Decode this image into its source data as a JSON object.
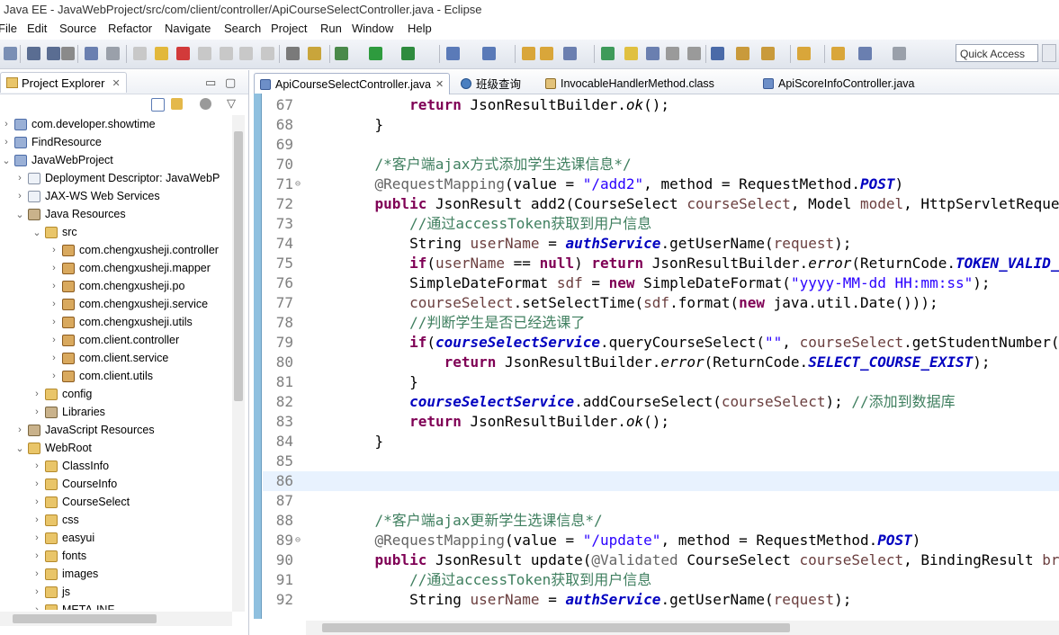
{
  "window": {
    "title": "Java EE - JavaWebProject/src/com/client/controller/ApiCourseSelectController.java - Eclipse"
  },
  "menu": [
    "File",
    "Edit",
    "Source",
    "Refactor",
    "Navigate",
    "Search",
    "Project",
    "Run",
    "Window",
    "Help"
  ],
  "toolbar": {
    "quick_access": "Quick Access"
  },
  "project_explorer": {
    "title": "Project Explorer",
    "items": [
      {
        "label": "com.developer.showtime",
        "indent": 0,
        "arrow": "›",
        "icon": "proj"
      },
      {
        "label": "FindResource",
        "indent": 0,
        "arrow": "›",
        "icon": "proj"
      },
      {
        "label": "JavaWebProject",
        "indent": 0,
        "arrow": "⌄",
        "icon": "proj"
      },
      {
        "label": "Deployment Descriptor: JavaWebP",
        "indent": 1,
        "arrow": "›",
        "icon": "file"
      },
      {
        "label": "JAX-WS Web Services",
        "indent": 1,
        "arrow": "›",
        "icon": "file"
      },
      {
        "label": "Java Resources",
        "indent": 1,
        "arrow": "⌄",
        "icon": "jar"
      },
      {
        "label": "src",
        "indent": 2,
        "arrow": "⌄",
        "icon": "folder"
      },
      {
        "label": "com.chengxusheji.controller",
        "indent": 3,
        "arrow": "›",
        "icon": "pkg"
      },
      {
        "label": "com.chengxusheji.mapper",
        "indent": 3,
        "arrow": "›",
        "icon": "pkg"
      },
      {
        "label": "com.chengxusheji.po",
        "indent": 3,
        "arrow": "›",
        "icon": "pkg"
      },
      {
        "label": "com.chengxusheji.service",
        "indent": 3,
        "arrow": "›",
        "icon": "pkg"
      },
      {
        "label": "com.chengxusheji.utils",
        "indent": 3,
        "arrow": "›",
        "icon": "pkg"
      },
      {
        "label": "com.client.controller",
        "indent": 3,
        "arrow": "›",
        "icon": "pkg"
      },
      {
        "label": "com.client.service",
        "indent": 3,
        "arrow": "›",
        "icon": "pkg"
      },
      {
        "label": "com.client.utils",
        "indent": 3,
        "arrow": "›",
        "icon": "pkg"
      },
      {
        "label": "config",
        "indent": 2,
        "arrow": "›",
        "icon": "folder"
      },
      {
        "label": "Libraries",
        "indent": 2,
        "arrow": "›",
        "icon": "jar"
      },
      {
        "label": "JavaScript Resources",
        "indent": 1,
        "arrow": "›",
        "icon": "jar"
      },
      {
        "label": "WebRoot",
        "indent": 1,
        "arrow": "⌄",
        "icon": "folder"
      },
      {
        "label": "ClassInfo",
        "indent": 2,
        "arrow": "›",
        "icon": "folder"
      },
      {
        "label": "CourseInfo",
        "indent": 2,
        "arrow": "›",
        "icon": "folder"
      },
      {
        "label": "CourseSelect",
        "indent": 2,
        "arrow": "›",
        "icon": "folder"
      },
      {
        "label": "css",
        "indent": 2,
        "arrow": "›",
        "icon": "folder"
      },
      {
        "label": "easyui",
        "indent": 2,
        "arrow": "›",
        "icon": "folder"
      },
      {
        "label": "fonts",
        "indent": 2,
        "arrow": "›",
        "icon": "folder"
      },
      {
        "label": "images",
        "indent": 2,
        "arrow": "›",
        "icon": "folder"
      },
      {
        "label": "js",
        "indent": 2,
        "arrow": "›",
        "icon": "folder"
      },
      {
        "label": "META-INF",
        "indent": 2,
        "arrow": "›",
        "icon": "folder"
      }
    ]
  },
  "editor": {
    "tabs": [
      {
        "label": "ApiCourseSelectController.java",
        "icon": "java",
        "active": true,
        "close": "✕"
      },
      {
        "label": "班级查询",
        "icon": "globe",
        "active": false,
        "close": ""
      },
      {
        "label": "InvocableHandlerMethod.class",
        "icon": "class",
        "active": false,
        "close": ""
      },
      {
        "label": "ApiScoreInfoController.java",
        "icon": "java",
        "active": false,
        "close": ""
      }
    ],
    "lines": [
      {
        "n": "67",
        "fold": "",
        "hl": false,
        "segs": [
          [
            "        ",
            ""
          ],
          [
            "return",
            "kw"
          ],
          [
            " JsonResultBuilder.",
            ""
          ],
          [
            "ok",
            "it"
          ],
          [
            "();",
            ""
          ]
        ]
      },
      {
        "n": "68",
        "fold": "",
        "hl": false,
        "segs": [
          [
            "    }",
            ""
          ]
        ]
      },
      {
        "n": "69",
        "fold": "",
        "hl": false,
        "segs": [
          [
            "",
            ""
          ]
        ]
      },
      {
        "n": "70",
        "fold": "",
        "hl": false,
        "segs": [
          [
            "    ",
            ""
          ],
          [
            "/*客户端ajax方式添加学生选课信息*/",
            "cm"
          ]
        ]
      },
      {
        "n": "71",
        "fold": "⊖",
        "hl": false,
        "segs": [
          [
            "    ",
            ""
          ],
          [
            "@RequestMapping",
            "an"
          ],
          [
            "(value = ",
            ""
          ],
          [
            "\"/add2\"",
            "st"
          ],
          [
            ", method = RequestMethod.",
            ""
          ],
          [
            "POST",
            "fi"
          ],
          [
            ")",
            ""
          ]
        ]
      },
      {
        "n": "72",
        "fold": "",
        "hl": false,
        "segs": [
          [
            "    ",
            ""
          ],
          [
            "public",
            "kw"
          ],
          [
            " JsonResult add2(CourseSelect ",
            ""
          ],
          [
            "courseSelect",
            "pv"
          ],
          [
            ", Model ",
            ""
          ],
          [
            "model",
            "pv"
          ],
          [
            ", HttpServletReques",
            ""
          ]
        ]
      },
      {
        "n": "73",
        "fold": "",
        "hl": false,
        "segs": [
          [
            "        ",
            ""
          ],
          [
            "//通过accessToken获取到用户信息",
            "cm"
          ]
        ]
      },
      {
        "n": "74",
        "fold": "",
        "hl": false,
        "segs": [
          [
            "        String ",
            ""
          ],
          [
            "userName",
            "pv"
          ],
          [
            " = ",
            ""
          ],
          [
            "authService",
            "fi"
          ],
          [
            ".getUserName(",
            ""
          ],
          [
            "request",
            "pv"
          ],
          [
            ");",
            ""
          ]
        ]
      },
      {
        "n": "75",
        "fold": "",
        "hl": false,
        "segs": [
          [
            "        ",
            ""
          ],
          [
            "if",
            "kw"
          ],
          [
            "(",
            ""
          ],
          [
            "userName",
            "pv"
          ],
          [
            " == ",
            ""
          ],
          [
            "null",
            "kw"
          ],
          [
            ") ",
            ""
          ],
          [
            "return",
            "kw"
          ],
          [
            " JsonResultBuilder.",
            ""
          ],
          [
            "error",
            "it"
          ],
          [
            "(ReturnCode.",
            ""
          ],
          [
            "TOKEN_VALID_E",
            "fi"
          ]
        ]
      },
      {
        "n": "76",
        "fold": "",
        "hl": false,
        "segs": [
          [
            "        SimpleDateFormat ",
            ""
          ],
          [
            "sdf",
            "pv"
          ],
          [
            " = ",
            ""
          ],
          [
            "new",
            "kw"
          ],
          [
            " SimpleDateFormat(",
            ""
          ],
          [
            "\"yyyy-MM-dd HH:mm:ss\"",
            "st"
          ],
          [
            ");",
            ""
          ]
        ]
      },
      {
        "n": "77",
        "fold": "",
        "hl": false,
        "segs": [
          [
            "        ",
            ""
          ],
          [
            "courseSelect",
            "pv"
          ],
          [
            ".setSelectTime(",
            ""
          ],
          [
            "sdf",
            "pv"
          ],
          [
            ".format(",
            ""
          ],
          [
            "new",
            "kw"
          ],
          [
            " java.util.Date()));",
            ""
          ]
        ]
      },
      {
        "n": "78",
        "fold": "",
        "hl": false,
        "segs": [
          [
            "        ",
            ""
          ],
          [
            "//判断学生是否已经选课了",
            "cm"
          ]
        ]
      },
      {
        "n": "79",
        "fold": "",
        "hl": false,
        "segs": [
          [
            "        ",
            ""
          ],
          [
            "if",
            "kw"
          ],
          [
            "(",
            ""
          ],
          [
            "courseSelectService",
            "fi"
          ],
          [
            ".queryCourseSelect(",
            ""
          ],
          [
            "\"\"",
            "st"
          ],
          [
            ", ",
            ""
          ],
          [
            "courseSelect",
            "pv"
          ],
          [
            ".getStudentNumber()",
            ""
          ]
        ]
      },
      {
        "n": "80",
        "fold": "",
        "hl": false,
        "segs": [
          [
            "            ",
            ""
          ],
          [
            "return",
            "kw"
          ],
          [
            " JsonResultBuilder.",
            ""
          ],
          [
            "error",
            "it"
          ],
          [
            "(ReturnCode.",
            ""
          ],
          [
            "SELECT_COURSE_EXIST",
            "fi"
          ],
          [
            ");",
            ""
          ]
        ]
      },
      {
        "n": "81",
        "fold": "",
        "hl": false,
        "segs": [
          [
            "        }",
            ""
          ]
        ]
      },
      {
        "n": "82",
        "fold": "",
        "hl": false,
        "segs": [
          [
            "        ",
            ""
          ],
          [
            "courseSelectService",
            "fi"
          ],
          [
            ".addCourseSelect(",
            ""
          ],
          [
            "courseSelect",
            "pv"
          ],
          [
            "); ",
            ""
          ],
          [
            "//添加到数据库",
            "cm"
          ]
        ]
      },
      {
        "n": "83",
        "fold": "",
        "hl": false,
        "segs": [
          [
            "        ",
            ""
          ],
          [
            "return",
            "kw"
          ],
          [
            " JsonResultBuilder.",
            ""
          ],
          [
            "ok",
            "it"
          ],
          [
            "();",
            ""
          ]
        ]
      },
      {
        "n": "84",
        "fold": "",
        "hl": false,
        "segs": [
          [
            "    }",
            ""
          ]
        ]
      },
      {
        "n": "85",
        "fold": "",
        "hl": false,
        "segs": [
          [
            "",
            ""
          ]
        ]
      },
      {
        "n": "86",
        "fold": "",
        "hl": true,
        "segs": [
          [
            "",
            ""
          ]
        ]
      },
      {
        "n": "87",
        "fold": "",
        "hl": false,
        "segs": [
          [
            "",
            ""
          ]
        ]
      },
      {
        "n": "88",
        "fold": "",
        "hl": false,
        "segs": [
          [
            "    ",
            ""
          ],
          [
            "/*客户端ajax更新学生选课信息*/",
            "cm"
          ]
        ]
      },
      {
        "n": "89",
        "fold": "⊖",
        "hl": false,
        "segs": [
          [
            "    ",
            ""
          ],
          [
            "@RequestMapping",
            "an"
          ],
          [
            "(value = ",
            ""
          ],
          [
            "\"/update\"",
            "st"
          ],
          [
            ", method = RequestMethod.",
            ""
          ],
          [
            "POST",
            "fi"
          ],
          [
            ")",
            ""
          ]
        ]
      },
      {
        "n": "90",
        "fold": "",
        "hl": false,
        "segs": [
          [
            "    ",
            ""
          ],
          [
            "public",
            "kw"
          ],
          [
            " JsonResult update(",
            ""
          ],
          [
            "@Validated",
            "an"
          ],
          [
            " CourseSelect ",
            ""
          ],
          [
            "courseSelect",
            "pv"
          ],
          [
            ", BindingResult ",
            ""
          ],
          [
            "br",
            "pv"
          ],
          [
            ",",
            ""
          ]
        ]
      },
      {
        "n": "91",
        "fold": "",
        "hl": false,
        "segs": [
          [
            "        ",
            ""
          ],
          [
            "//通过accessToken获取到用户信息",
            "cm"
          ]
        ]
      },
      {
        "n": "92",
        "fold": "",
        "hl": false,
        "segs": [
          [
            "        String ",
            ""
          ],
          [
            "userName",
            "pv"
          ],
          [
            " = ",
            ""
          ],
          [
            "authService",
            "fi"
          ],
          [
            ".getUserName(",
            ""
          ],
          [
            "request",
            "pv"
          ],
          [
            ");",
            ""
          ]
        ]
      }
    ]
  }
}
